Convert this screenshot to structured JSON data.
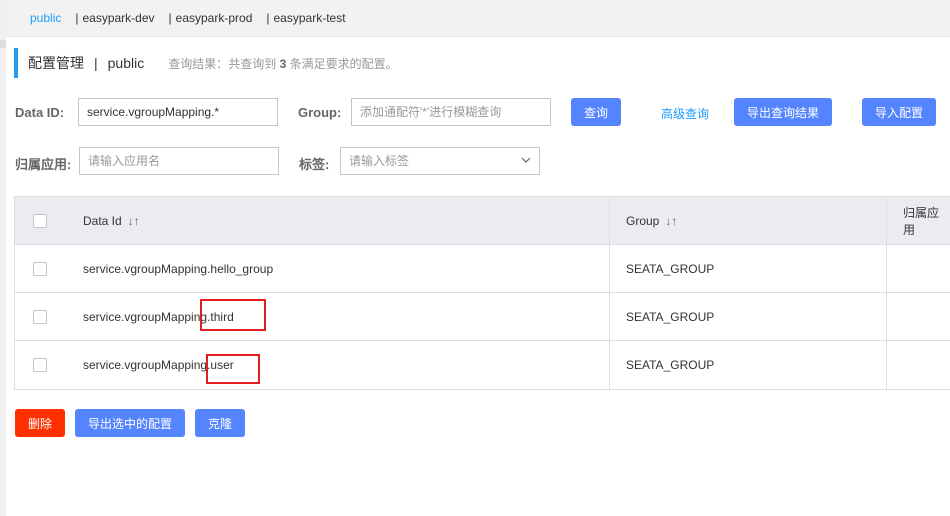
{
  "namespaces": [
    {
      "label": "public",
      "active": true
    },
    {
      "label": "easypark-dev",
      "active": false
    },
    {
      "label": "easypark-prod",
      "active": false
    },
    {
      "label": "easypark-test",
      "active": false
    }
  ],
  "namespace_separator": "|",
  "title": {
    "main": "配置管理",
    "divider": "|",
    "namespace": "public",
    "hint_prefix": "查询结果：共查询到",
    "hint_count": "3",
    "hint_suffix": "条满足要求的配置。"
  },
  "filters": {
    "dataid_label": "Data ID:",
    "dataid_value": "service.vgroupMapping.*",
    "group_label": "Group:",
    "group_placeholder": "添加通配符'*'进行模糊查询",
    "app_label": "归属应用:",
    "app_placeholder": "请输入应用名",
    "tag_label": "标签:",
    "tag_placeholder": "请输入标签"
  },
  "actions": {
    "query": "查询",
    "advanced_query": "高级查询",
    "export_results": "导出查询结果",
    "import_config": "导入配置"
  },
  "table": {
    "headers": {
      "dataid": "Data Id",
      "group": "Group",
      "app": "归属应用",
      "sort_icon": "↓↑"
    },
    "rows": [
      {
        "dataid": "service.vgroupMapping.hello_group",
        "group": "SEATA_GROUP",
        "app": ""
      },
      {
        "dataid": "service.vgroupMapping.third",
        "group": "SEATA_GROUP",
        "app": ""
      },
      {
        "dataid": "service.vgroupMapping.user",
        "group": "SEATA_GROUP",
        "app": ""
      }
    ]
  },
  "bottom_actions": {
    "delete": "删除",
    "export_selected": "导出选中的配置",
    "clone": "克隆"
  },
  "colors": {
    "primary": "#5584ff",
    "link": "#209bfa",
    "danger": "#ff3000",
    "highlight": "#e02020"
  }
}
